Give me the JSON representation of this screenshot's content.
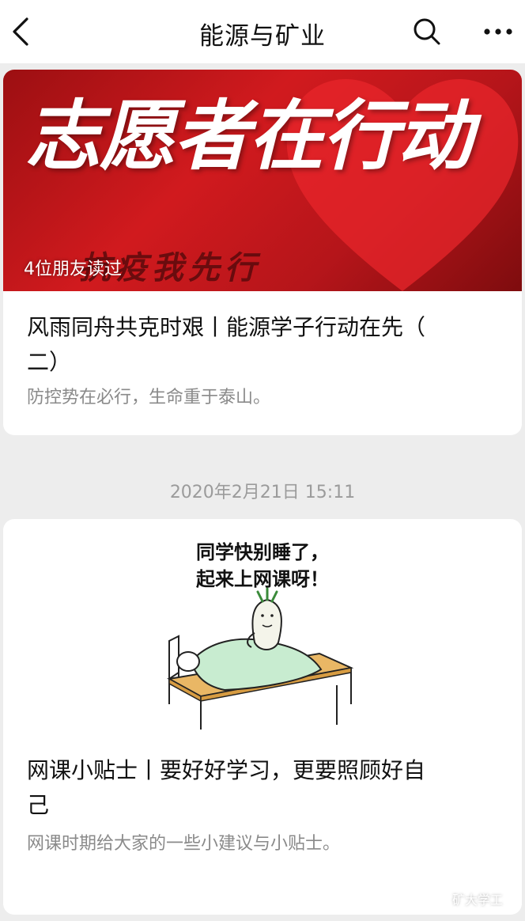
{
  "header": {
    "title": "能源与矿业",
    "back_icon": "chevron-left-icon",
    "search_icon": "search-icon",
    "more_icon": "more-horizontal-icon"
  },
  "articles": [
    {
      "cover": {
        "headline": "志愿者在行动",
        "subline": "抗疫我先行",
        "friends_read": "4位朋友读过",
        "colors": {
          "background": "#c8161b",
          "text": "#ffffff"
        }
      },
      "title": "风雨同舟共克时艰丨能源学子行动在先（二）",
      "title_line1": "风雨同舟共克时艰丨能源学子行动在先（",
      "title_line2": "二）",
      "description": "防控势在必行，生命重于泰山。"
    },
    {
      "timestamp": "2020年2月21日 15:11",
      "cover": {
        "caption_line1": "同学快别睡了，",
        "caption_line2": "起来上网课呀！"
      },
      "title": "网课小贴士丨要好好学习，更要照顾好自己",
      "title_line1": "网课小贴士丨要好好学习，更要照顾好自",
      "title_line2": "己",
      "description": "网课时期给大家的一些小建议与小贴士。"
    }
  ],
  "watermark": {
    "text": "矿大学工",
    "icon": "wechat-icon"
  },
  "colors": {
    "page_bg": "#ededed",
    "card_bg": "#ffffff",
    "title_text": "#111111",
    "desc_text": "#8a8a8a",
    "timestamp_text": "#9b9b9b"
  }
}
